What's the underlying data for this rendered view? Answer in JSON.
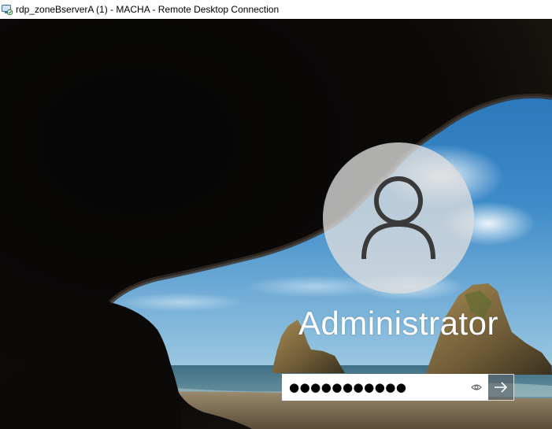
{
  "window": {
    "title": "rdp_zoneBserverA (1) - MACHA - Remote Desktop Connection",
    "icon": "remote-desktop-icon"
  },
  "lock_screen": {
    "background": "cave-arch-beach-wallpaper",
    "avatar_icon": "user-silhouette-icon",
    "username": "Administrator",
    "password": {
      "value": "●●●●●●●●●●●",
      "reveal_icon": "eye-icon"
    },
    "submit_icon": "arrow-right-icon"
  },
  "colors": {
    "titlebar_bg": "#ffffff",
    "avatar_bg": "#dedede",
    "username_text": "#ffffff",
    "submit_bg": "#5a5a5a"
  }
}
